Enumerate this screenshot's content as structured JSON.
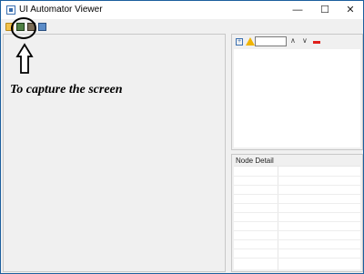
{
  "window": {
    "title": "UI Automator Viewer",
    "minimize_glyph": "—",
    "maximize_glyph": "☐",
    "close_glyph": "✕"
  },
  "toolbar": {
    "icons": [
      "open-folder-icon",
      "device-screenshot-icon",
      "device-screenshot-compressed-icon",
      "save-icon"
    ]
  },
  "annotation": {
    "caption": "To capture the screen"
  },
  "hierarchy_panel": {
    "search_value": "",
    "up_glyph": "∧",
    "down_glyph": "∨"
  },
  "node_detail": {
    "label": "Node Detail"
  },
  "colors": {
    "window_border": "#1c5f9e",
    "panel_bg": "#f0f0f0",
    "warning": "#f0b400",
    "clear": "#e0201c"
  }
}
